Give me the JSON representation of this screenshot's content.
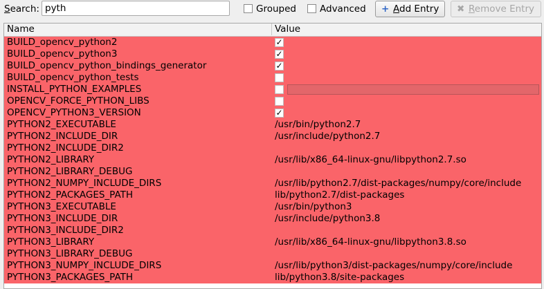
{
  "toolbar": {
    "search_label_hotkey": "S",
    "search_label_rest": "earch:",
    "search_value": "pyth",
    "grouped_label": "Grouped",
    "grouped_checked": false,
    "advanced_label": "Advanced",
    "advanced_checked": false,
    "add_entry_hotkey": "A",
    "add_entry_rest": "dd Entry",
    "add_icon": "+",
    "remove_entry_hotkey": "R",
    "remove_entry_rest": "emove Entry",
    "remove_icon": "✖"
  },
  "table": {
    "columns": {
      "name": "Name",
      "value": "Value"
    },
    "row_color": "#fa6469",
    "rows": [
      {
        "name": "BUILD_opencv_python2",
        "kind": "bool",
        "checked": true,
        "value": ""
      },
      {
        "name": "BUILD_opencv_python3",
        "kind": "bool",
        "checked": true,
        "value": ""
      },
      {
        "name": "BUILD_opencv_python_bindings_generator",
        "kind": "bool",
        "checked": true,
        "value": ""
      },
      {
        "name": "BUILD_opencv_python_tests",
        "kind": "bool",
        "checked": false,
        "value": ""
      },
      {
        "name": "INSTALL_PYTHON_EXAMPLES",
        "kind": "bool",
        "checked": false,
        "value": "",
        "editing": true
      },
      {
        "name": "OPENCV_FORCE_PYTHON_LIBS",
        "kind": "bool",
        "checked": false,
        "value": ""
      },
      {
        "name": "OPENCV_PYTHON3_VERSION",
        "kind": "bool",
        "checked": true,
        "value": ""
      },
      {
        "name": "PYTHON2_EXECUTABLE",
        "kind": "text",
        "value": "/usr/bin/python2.7"
      },
      {
        "name": "PYTHON2_INCLUDE_DIR",
        "kind": "text",
        "value": "/usr/include/python2.7"
      },
      {
        "name": "PYTHON2_INCLUDE_DIR2",
        "kind": "text",
        "value": ""
      },
      {
        "name": "PYTHON2_LIBRARY",
        "kind": "text",
        "value": "/usr/lib/x86_64-linux-gnu/libpython2.7.so"
      },
      {
        "name": "PYTHON2_LIBRARY_DEBUG",
        "kind": "text",
        "value": ""
      },
      {
        "name": "PYTHON2_NUMPY_INCLUDE_DIRS",
        "kind": "text",
        "value": "/usr/lib/python2.7/dist-packages/numpy/core/include"
      },
      {
        "name": "PYTHON2_PACKAGES_PATH",
        "kind": "text",
        "value": "lib/python2.7/dist-packages"
      },
      {
        "name": "PYTHON3_EXECUTABLE",
        "kind": "text",
        "value": "/usr/bin/python3"
      },
      {
        "name": "PYTHON3_INCLUDE_DIR",
        "kind": "text",
        "value": "/usr/include/python3.8"
      },
      {
        "name": "PYTHON3_INCLUDE_DIR2",
        "kind": "text",
        "value": ""
      },
      {
        "name": "PYTHON3_LIBRARY",
        "kind": "text",
        "value": "/usr/lib/x86_64-linux-gnu/libpython3.8.so"
      },
      {
        "name": "PYTHON3_LIBRARY_DEBUG",
        "kind": "text",
        "value": ""
      },
      {
        "name": "PYTHON3_NUMPY_INCLUDE_DIRS",
        "kind": "text",
        "value": "/usr/lib/python3/dist-packages/numpy/core/include"
      },
      {
        "name": "PYTHON3_PACKAGES_PATH",
        "kind": "text",
        "value": "lib/python3.8/site-packages"
      }
    ]
  }
}
